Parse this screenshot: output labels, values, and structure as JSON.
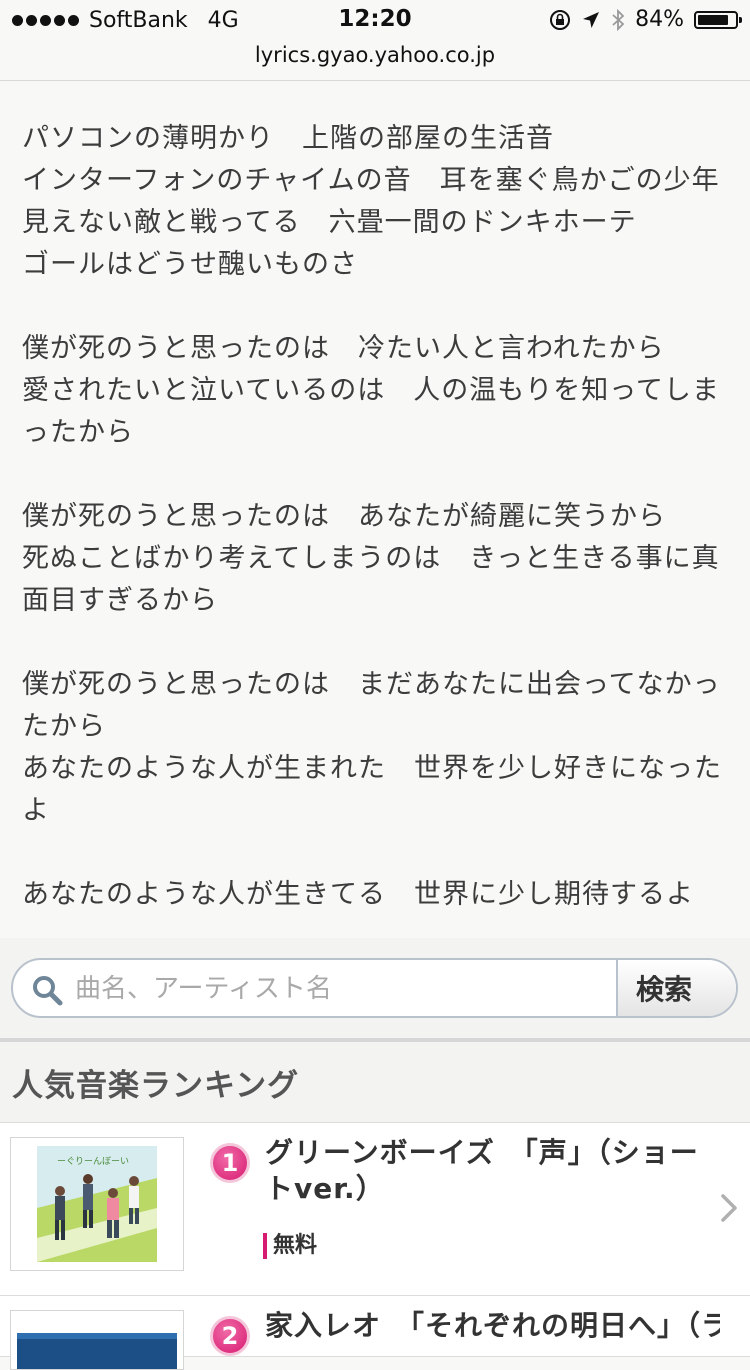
{
  "status_bar": {
    "carrier": "SoftBank",
    "network": "4G",
    "time": "12:20",
    "battery_percent": "84%",
    "battery_level": 0.84
  },
  "browser": {
    "url": "lyrics.gyao.yahoo.co.jp"
  },
  "lyrics": {
    "stanzas": [
      [
        "パソコンの薄明かり　上階の部屋の生活音",
        "インターフォンのチャイムの音　耳を塞ぐ鳥かごの少年",
        "見えない敵と戦ってる　六畳一間のドンキホーテ",
        "ゴールはどうせ醜いものさ"
      ],
      [
        "僕が死のうと思ったのは　冷たい人と言われたから",
        "愛されたいと泣いているのは　人の温もりを知ってしまったから"
      ],
      [
        "僕が死のうと思ったのは　あなたが綺麗に笑うから",
        "死ぬことばかり考えてしまうのは　きっと生きる事に真面目すぎるから"
      ],
      [
        "僕が死のうと思ったのは　まだあなたに出会ってなかったから",
        "あなたのような人が生まれた　世界を少し好きになったよ"
      ],
      [
        "あなたのような人が生きてる　世界に少し期待するよ"
      ]
    ]
  },
  "search": {
    "placeholder": "曲名、アーティスト名",
    "button_label": "検索"
  },
  "ranking": {
    "title": "人気音楽ランキング",
    "items": [
      {
        "rank": "1",
        "title": "グリーンボーイズ　「声」（ショートver.）",
        "badge_label": "無料"
      },
      {
        "rank": "2",
        "title": "家入レオ　「それぞれの明日へ」（ラ"
      }
    ]
  },
  "colors": {
    "accent": "#d81b72",
    "background": "#f8f8f6",
    "text": "#3c3c3c"
  }
}
